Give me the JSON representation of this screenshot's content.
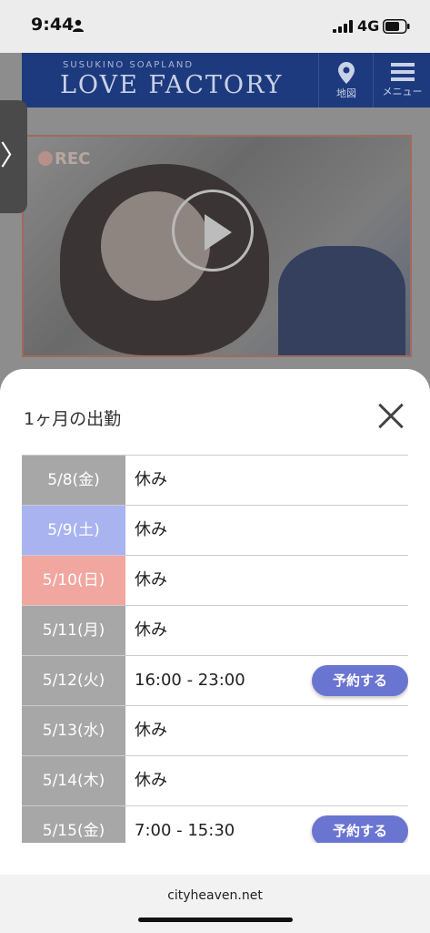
{
  "status_bar": {
    "time": "9:44",
    "network": "4G"
  },
  "background_page": {
    "site_subtitle": "SUSUKINO SOAPLAND",
    "site_name": "LOVE FACTORY",
    "map_label": "地図",
    "menu_label": "メニュー",
    "side_tab_glyph": "〉",
    "rec_label": "REC"
  },
  "schedule_sheet": {
    "title": "1ヶ月の出勤",
    "colors": {
      "weekday": "#a7a7a7",
      "saturday": "#a8b3f0",
      "sunday": "#f1a79f",
      "reserve_button": "#6a74d1"
    },
    "rows": [
      {
        "date": "5/8(金)",
        "time": "休み",
        "reserve": ""
      },
      {
        "date": "5/9(土)",
        "time": "休み",
        "reserve": ""
      },
      {
        "date": "5/10(日)",
        "time": "休み",
        "reserve": ""
      },
      {
        "date": "5/11(月)",
        "time": "休み",
        "reserve": ""
      },
      {
        "date": "5/12(火)",
        "time": "16:00 - 23:00",
        "reserve": "予約する"
      },
      {
        "date": "5/13(水)",
        "time": "休み",
        "reserve": ""
      },
      {
        "date": "5/14(木)",
        "time": "休み",
        "reserve": ""
      },
      {
        "date": "5/15(金)",
        "time": "7:00 - 15:30",
        "reserve": "予約する"
      }
    ]
  },
  "footer": {
    "domain": "cityheaven.net"
  }
}
